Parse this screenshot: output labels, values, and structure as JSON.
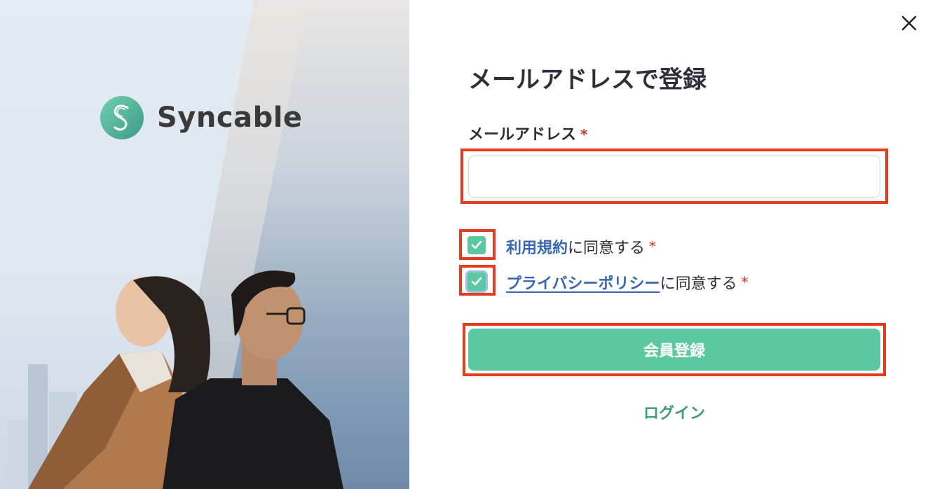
{
  "brand": {
    "name": "Syncable",
    "color": "#5cc8a0"
  },
  "form": {
    "title": "メールアドレスで登録",
    "email_label": "メールアドレス",
    "required_mark": "*",
    "email_value": "",
    "terms_link": "利用規約",
    "terms_suffix": "に同意する",
    "privacy_link": "プライバシーポリシー",
    "privacy_suffix": "に同意する",
    "terms_checked": true,
    "privacy_checked": true,
    "submit_label": "会員登録",
    "login_label": "ログイン"
  },
  "icons": {
    "close": "close-icon",
    "check": "checkmark-icon",
    "logo": "syncable-logo-icon"
  },
  "colors": {
    "accent": "#5cc8a0",
    "link": "#3968b3",
    "login": "#3e9a7a",
    "required": "#d9342b",
    "highlight": "#e53c1e"
  }
}
